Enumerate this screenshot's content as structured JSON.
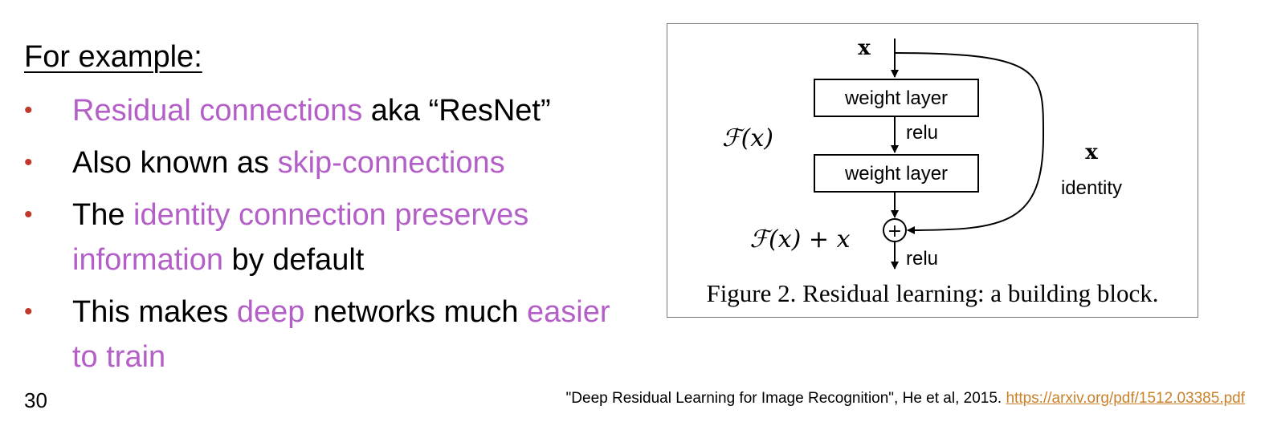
{
  "heading": "For example:",
  "bullets": [
    {
      "segments": [
        {
          "text": "Residual connections",
          "hl": true
        },
        {
          "text": " aka “ResNet”",
          "hl": false
        }
      ]
    },
    {
      "segments": [
        {
          "text": "Also known as ",
          "hl": false
        },
        {
          "text": "skip-connections",
          "hl": true
        }
      ]
    },
    {
      "segments": [
        {
          "text": "The ",
          "hl": false
        },
        {
          "text": "identity connection preserves information",
          "hl": true
        },
        {
          "text": " by default",
          "hl": false
        }
      ]
    },
    {
      "segments": [
        {
          "text": "This makes ",
          "hl": false
        },
        {
          "text": "deep",
          "hl": true
        },
        {
          "text": " networks much ",
          "hl": false
        },
        {
          "text": "easier to train",
          "hl": true
        }
      ]
    }
  ],
  "bullet_symbol": "•",
  "page_number": "30",
  "citation": {
    "text": "\"Deep Residual Learning for Image Recognition\", He et al, 2015.",
    "link": "https://arxiv.org/pdf/1512.03385.pdf"
  },
  "figure": {
    "input_label": "x",
    "layer1": "weight layer",
    "relu1": "relu",
    "layer2": "weight layer",
    "fx_label": "ℱ(x)",
    "sum_label": "ℱ(x) + x",
    "plus_symbol": "+",
    "relu_out": "relu",
    "identity_x": "x",
    "identity_label": "identity",
    "caption": "Figure 2. Residual learning: a building block."
  },
  "colors": {
    "highlight": "#b35fc7",
    "bullet": "#c0392b",
    "link": "#c9822a"
  }
}
